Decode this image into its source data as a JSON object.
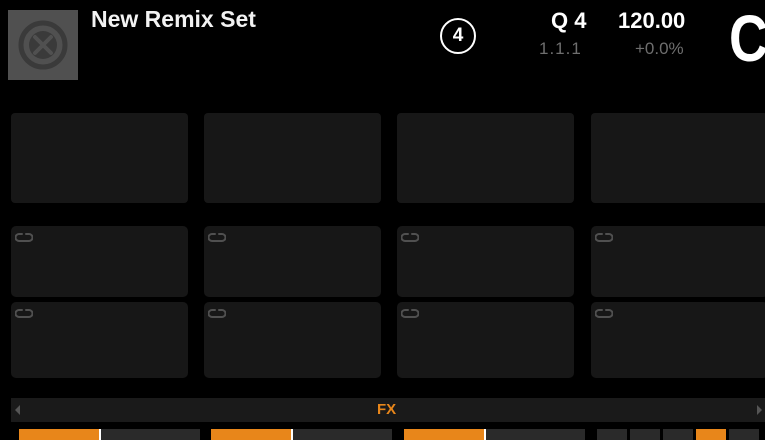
{
  "header": {
    "title": "New Remix Set",
    "cover_icon": "remix-set-icon",
    "deck_badge": "4",
    "quantize": "Q 4",
    "position": "1.1.1",
    "tempo": "120.00",
    "tempo_offset": "+0.0%",
    "deck_letter": "C"
  },
  "grid": {
    "columns": [
      {
        "top_cell": "empty",
        "mid_cell_icon": "loop-icon",
        "bot_cell_icon": "loop-icon"
      },
      {
        "top_cell": "empty",
        "mid_cell_icon": "loop-icon",
        "bot_cell_icon": "loop-icon"
      },
      {
        "top_cell": "empty",
        "mid_cell_icon": "loop-icon",
        "bot_cell_icon": "loop-icon"
      },
      {
        "top_cell": "empty",
        "mid_cell_icon": "loop-icon",
        "bot_cell_icon": "loop-icon"
      }
    ]
  },
  "fx_bar": {
    "label": "FX",
    "left_arrow_icon": "chevron-left-icon",
    "right_arrow_icon": "chevron-right-icon"
  },
  "meters": [
    {
      "name": "slot-1",
      "level": 0.44,
      "marker": 0.44
    },
    {
      "name": "slot-2",
      "level": 0.44,
      "marker": 0.44
    },
    {
      "name": "slot-3",
      "level": 0.44,
      "marker": 0.44
    },
    {
      "name": "slot-4",
      "segments": 5,
      "active_segment": 4
    }
  ],
  "colors": {
    "accent": "#e8861a",
    "background": "#000000",
    "cell": "#171717",
    "text_primary": "#ffffff",
    "text_secondary": "#6e6e6e"
  }
}
